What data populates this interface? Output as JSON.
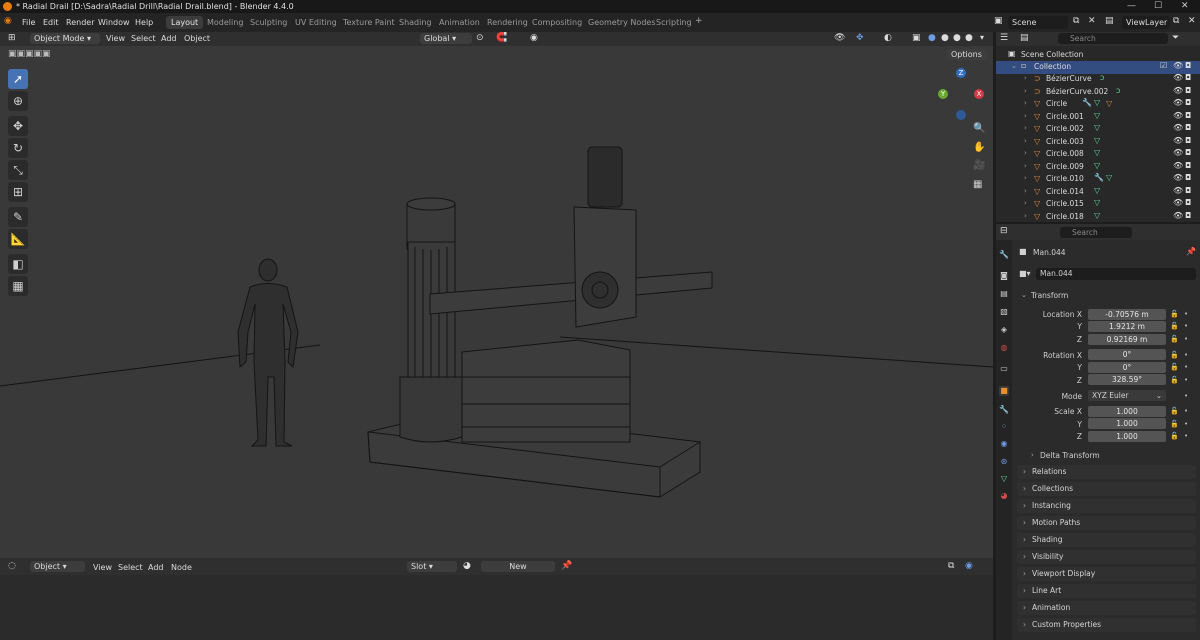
{
  "title_bar": {
    "title": "* Radial Drail [D:\\Sadra\\Radial Drill\\Radial Drail.blend] - Blender 4.4.0"
  },
  "menu": {
    "items": [
      "File",
      "Edit",
      "Render",
      "Window",
      "Help"
    ]
  },
  "workspaces": [
    "Layout",
    "Modeling",
    "Sculpting",
    "UV Editing",
    "Texture Paint",
    "Shading",
    "Animation",
    "Rendering",
    "Compositing",
    "Geometry Nodes",
    "Scripting"
  ],
  "active_workspace": "Layout",
  "scene": {
    "scene_name": "Scene",
    "view_layer": "ViewLayer"
  },
  "viewport_header": {
    "mode": "Object Mode",
    "menus": [
      "View",
      "Select",
      "Add",
      "Object"
    ],
    "orientation": "Global",
    "options": "Options"
  },
  "gizmo": {
    "z": "Z",
    "y": "Y",
    "x": "X"
  },
  "bottom_header": {
    "type": "Object",
    "menus": [
      "View",
      "Select",
      "Add",
      "Node"
    ],
    "slot": "Slot",
    "new": "New"
  },
  "outliner": {
    "search_placeholder": "Search",
    "scene_collection": "Scene Collection",
    "collection": "Collection",
    "items": [
      "BézierCurve",
      "BézierCurve.002",
      "Circle",
      "Circle.001",
      "Circle.002",
      "Circle.003",
      "Circle.008",
      "Circle.009",
      "Circle.010",
      "Circle.014",
      "Circle.015",
      "Circle.018"
    ]
  },
  "properties": {
    "search_placeholder": "Search",
    "object_name": "Man.044",
    "object_field": "Man.044",
    "transform_title": "Transform",
    "location_label": "Location X",
    "location": [
      "-0.70576 m",
      "1.9212 m",
      "0.92169 m"
    ],
    "rotation_label": "Rotation X",
    "rotation": [
      "0°",
      "0°",
      "328.59°"
    ],
    "mode_label": "Mode",
    "mode": "XYZ Euler",
    "scale_label": "Scale X",
    "scale": [
      "1.000",
      "1.000",
      "1.000"
    ],
    "axis": [
      "Y",
      "Z"
    ],
    "delta": "Delta Transform",
    "panels": [
      "Relations",
      "Collections",
      "Instancing",
      "Motion Paths",
      "Shading",
      "Visibility",
      "Viewport Display",
      "Line Art",
      "Animation",
      "Custom Properties"
    ]
  },
  "colors": {
    "accent": "#4772b3",
    "orange": "#e87d0d",
    "viewport": "#393939"
  }
}
